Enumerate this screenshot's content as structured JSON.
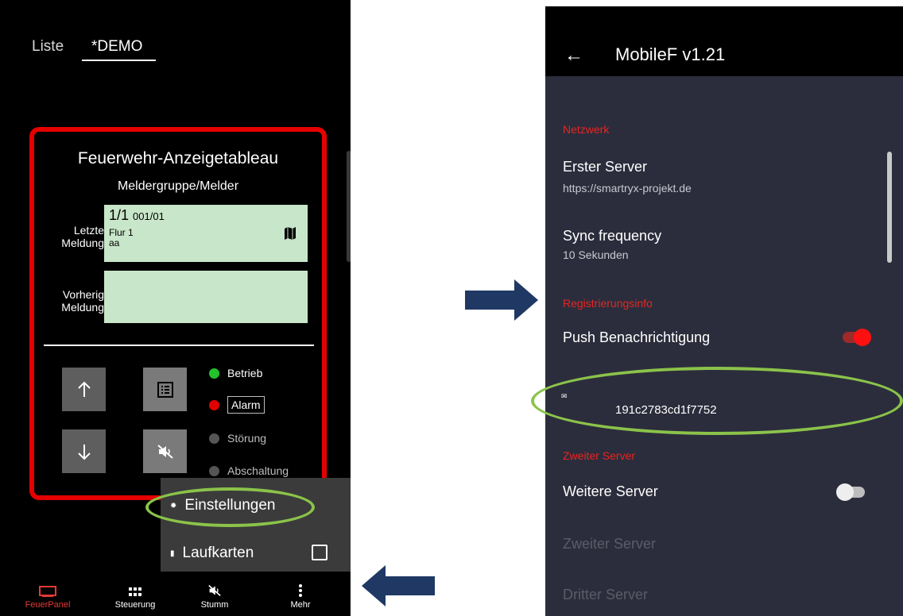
{
  "left": {
    "tabs": [
      "Liste",
      "*DEMO"
    ],
    "panel": {
      "title": "Feuerwehr-Anzeigetableau",
      "subtitle": "Meldergruppe/Melder",
      "last_label_1": "Letzte",
      "last_label_2": "Meldung",
      "last_id_main": "1/1",
      "last_id_sub": "001/01",
      "last_loc_1": "Flur 1",
      "last_loc_2": "aa",
      "prev_label_1": "Vorherig",
      "prev_label_2": "Meldung"
    },
    "status": {
      "betrieb": "Betrieb",
      "alarm": "Alarm",
      "stoerung": "Störung",
      "abschaltung": "Abschaltung",
      "colors": {
        "betrieb": "#22c32b",
        "alarm": "#e00000",
        "stoerung": "#555555",
        "abschaltung": "#555555"
      }
    },
    "menu": {
      "einstellungen": "Einstellungen",
      "laufkarten": "Laufkarten"
    },
    "nav": {
      "feuer": "FeuerPanel",
      "steuer": "Steuerung",
      "stumm": "Stumm",
      "mehr": "Mehr"
    }
  },
  "right": {
    "title": "MobileF v1.21",
    "cat_netz": "Netzwerk",
    "erster_title": "Erster Server",
    "erster_sub": "https://smartryx-projekt.de",
    "sync_title": "Sync frequency",
    "sync_sub": "10 Sekunden",
    "cat_reg": "Registrierungsinfo",
    "push_title": "Push Benachrichtigung",
    "push_on": true,
    "reg_id": "191c2783cd1f7752",
    "cat_zweit": "Zweiter Server",
    "weitere_title": "Weitere Server",
    "weitere_on": false,
    "zweiter_title": "Zweiter Server",
    "dritter_title": "Dritter Server"
  },
  "colors": {
    "accent_red": "#e52521",
    "highlight_green": "#8bc34a",
    "arrow_navy": "#1f3864"
  }
}
